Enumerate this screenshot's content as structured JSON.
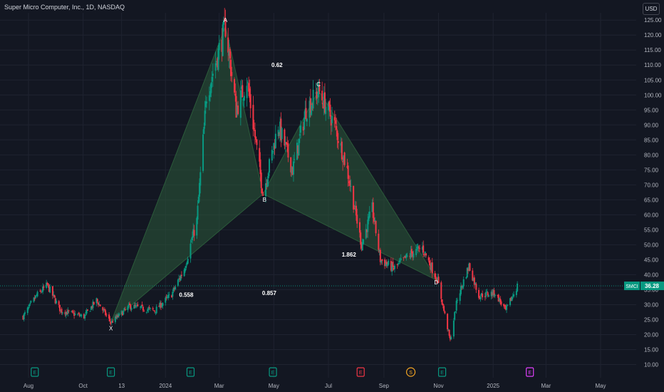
{
  "header": {
    "symbol_title": "Super Micro Computer, Inc., 1D, NASDAQ",
    "currency_label": "USD"
  },
  "price_tag": {
    "ticker": "SMCI",
    "value": "36.28",
    "price": 36.28,
    "color": "#089981"
  },
  "colors": {
    "background": "#131722",
    "grid": "#1f2330",
    "up": "#089981",
    "down": "#f23645",
    "pattern_fill": "#2b5a3a",
    "text": "#d1d4dc"
  },
  "chart_data": {
    "type": "candlestick",
    "y_axis": {
      "min": 10,
      "max": 125,
      "ticks": [
        "10.00",
        "15.00",
        "20.00",
        "25.00",
        "30.00",
        "35.00",
        "40.00",
        "45.00",
        "50.00",
        "55.00",
        "60.00",
        "65.00",
        "70.00",
        "75.00",
        "80.00",
        "85.00",
        "90.00",
        "95.00",
        "100.00",
        "105.00",
        "110.00",
        "115.00",
        "120.00",
        "125.00"
      ]
    },
    "x_axis": {
      "ticks": [
        "Aug",
        "Oct",
        "13",
        "2024",
        "Mar",
        "May",
        "Jul",
        "Sep",
        "Nov",
        "2025",
        "Mar",
        "May"
      ]
    },
    "harmonic_pattern": {
      "points": [
        {
          "label": "X",
          "date": "2023-11-01",
          "price": 24
        },
        {
          "label": "A",
          "date": "2024-03-08",
          "price": 122.9
        },
        {
          "label": "B",
          "date": "2024-04-19",
          "price": 67
        },
        {
          "label": "C",
          "date": "2024-06-20",
          "price": 101.5
        },
        {
          "label": "D",
          "date": "2024-10-31",
          "price": 38
        }
      ],
      "ratios": [
        {
          "text": "0.62",
          "between": "A-C"
        },
        {
          "text": "0.558",
          "between": "X-B"
        },
        {
          "text": "1.862",
          "between": "B-D"
        },
        {
          "text": "0.857",
          "between": "X-D"
        }
      ]
    },
    "events": [
      {
        "type": "E",
        "kind": "earnings",
        "date": "2023-08-08"
      },
      {
        "type": "E",
        "kind": "earnings",
        "date": "2023-11-01"
      },
      {
        "type": "E",
        "kind": "earnings",
        "date": "2024-01-29"
      },
      {
        "type": "E",
        "kind": "earnings",
        "date": "2024-04-30"
      },
      {
        "type": "E",
        "kind": "earnings-missed",
        "date": "2024-08-06"
      },
      {
        "type": "S",
        "kind": "split",
        "date": "2024-10-01"
      },
      {
        "type": "E",
        "kind": "earnings",
        "date": "2024-11-05"
      },
      {
        "type": "E",
        "kind": "earnings-upcoming",
        "date": "2025-02-11"
      }
    ],
    "price_path": [
      [
        "2023-07-26",
        26
      ],
      [
        "2023-08-10",
        33
      ],
      [
        "2023-08-22",
        36.5
      ],
      [
        "2023-09-06",
        28
      ],
      [
        "2023-10-02",
        26
      ],
      [
        "2023-10-16",
        31.5
      ],
      [
        "2023-11-01",
        24
      ],
      [
        "2023-11-22",
        29.5
      ],
      [
        "2023-12-20",
        28
      ],
      [
        "2024-01-08",
        33.5
      ],
      [
        "2024-01-22",
        42
      ],
      [
        "2024-02-05",
        58
      ],
      [
        "2024-02-16",
        100
      ],
      [
        "2024-03-08",
        122.9
      ],
      [
        "2024-03-20",
        95
      ],
      [
        "2024-04-01",
        105
      ],
      [
        "2024-04-19",
        67
      ],
      [
        "2024-05-06",
        90
      ],
      [
        "2024-05-22",
        75
      ],
      [
        "2024-06-06",
        95
      ],
      [
        "2024-06-20",
        101.5
      ],
      [
        "2024-07-08",
        90
      ],
      [
        "2024-07-22",
        75
      ],
      [
        "2024-08-07",
        50
      ],
      [
        "2024-08-19",
        62
      ],
      [
        "2024-08-28",
        45
      ],
      [
        "2024-09-12",
        42
      ],
      [
        "2024-10-01",
        47
      ],
      [
        "2024-10-14",
        49
      ],
      [
        "2024-10-31",
        38
      ],
      [
        "2024-11-14",
        18
      ],
      [
        "2024-11-22",
        32
      ],
      [
        "2024-12-05",
        43
      ],
      [
        "2024-12-16",
        33
      ],
      [
        "2025-01-03",
        34
      ],
      [
        "2025-01-15",
        28
      ],
      [
        "2025-01-28",
        36.28
      ]
    ],
    "last_price": 36.28
  }
}
